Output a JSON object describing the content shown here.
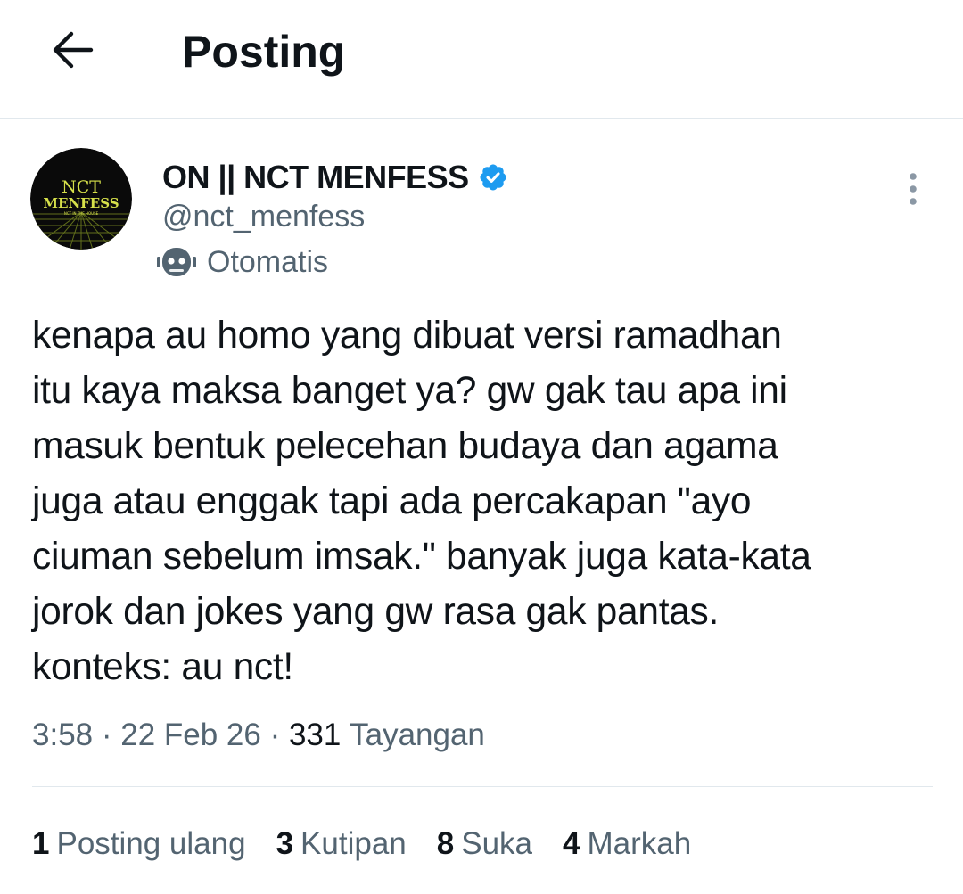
{
  "header": {
    "back_icon": "arrow-left-icon",
    "title": "Posting"
  },
  "author": {
    "avatar_text_line1": "NCT",
    "avatar_text_line2": "MENFESS",
    "avatar_subtext": "NCT IN THE HOUSE",
    "name": "ON || NCT MENFESS",
    "verified_icon": "verified-badge-icon",
    "handle": "@nct_menfess",
    "automated_icon": "robot-icon",
    "automated_label": "Otomatis",
    "more_icon": "more-vertical-icon"
  },
  "post": {
    "text": "kenapa au homo yang dibuat versi ramadhan\nitu kaya maksa banget ya? gw gak tau apa ini\nmasuk bentuk pelecehan budaya dan agama\njuga atau enggak tapi ada percakapan \"ayo\nciuman sebelum imsak.\" banyak juga kata-kata\njorok dan jokes yang gw rasa gak pantas.\nkonteks: au nct!",
    "time": "3:58",
    "date": "22 Feb 26",
    "separator": " · ",
    "views_count": "331",
    "views_label": "Tayangan"
  },
  "stats": [
    {
      "count": "1",
      "label": "Posting ulang"
    },
    {
      "count": "3",
      "label": "Kutipan"
    },
    {
      "count": "8",
      "label": "Suka"
    },
    {
      "count": "4",
      "label": "Markah"
    }
  ],
  "colors": {
    "text": "#0f1419",
    "secondary": "#536471",
    "verified": "#1d9bf0",
    "divider": "#e1e8ed",
    "avatar_bg": "#0a0a0a",
    "avatar_accent": "#d6e04a"
  }
}
